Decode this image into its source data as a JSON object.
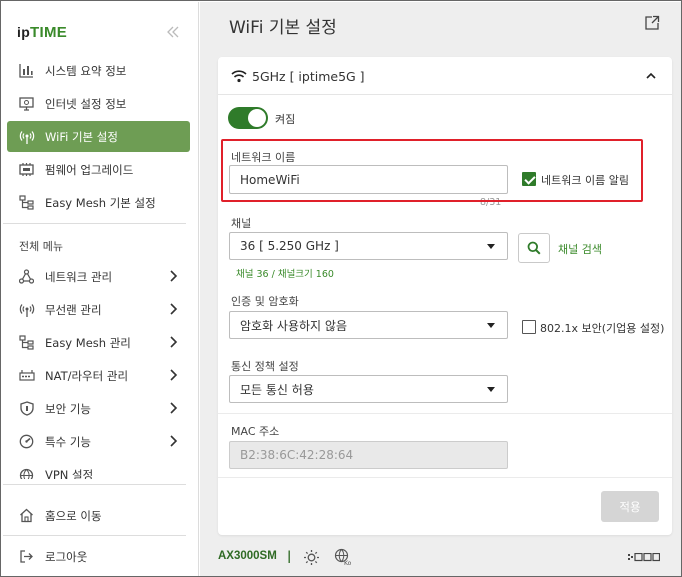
{
  "brand": {
    "logo_prefix": "ip",
    "logo_suffix": "TIME"
  },
  "sidebar": {
    "top_items": [
      {
        "label": "시스템 요약 정보",
        "icon": "bar-chart-icon"
      },
      {
        "label": "인터넷 설정 정보",
        "icon": "monitor-icon"
      },
      {
        "label": "WiFi 기본 설정",
        "icon": "wireless-icon",
        "active": true
      },
      {
        "label": "펌웨어 업그레이드",
        "icon": "chip-icon"
      },
      {
        "label": "Easy Mesh 기본 설정",
        "icon": "mesh-icon"
      }
    ],
    "section_title": "전체 메뉴",
    "menu_items": [
      {
        "label": "네트워크 관리",
        "icon": "network-icon"
      },
      {
        "label": "무선랜 관리",
        "icon": "wireless-icon"
      },
      {
        "label": "Easy Mesh 관리",
        "icon": "mesh-icon"
      },
      {
        "label": "NAT/라우터 관리",
        "icon": "router-icon"
      },
      {
        "label": "보안 기능",
        "icon": "shield-icon"
      },
      {
        "label": "특수 기능",
        "icon": "gauge-icon"
      },
      {
        "label": "VPN 설정",
        "icon": "vpn-icon"
      }
    ],
    "home_label": "홈으로 이동",
    "logout_label": "로그아웃"
  },
  "main": {
    "title": "WiFi 기본 설정",
    "card": {
      "band_title": "5GHz [ iptime5G ]",
      "toggle_label": "켜짐",
      "toggle_on": true,
      "ssid": {
        "label": "네트워크 이름",
        "value": "HomeWiFi",
        "counter": "8/31",
        "broadcast_label": "네트워크 이름 알림",
        "broadcast_checked": true
      },
      "channel": {
        "label": "채널",
        "selected": "36 [ 5.250 GHz ]",
        "hint": "채널 36 / 채널크기 160",
        "search_label": "채널 검색"
      },
      "auth": {
        "label": "인증 및 암호화",
        "selected": "암호화 사용하지 않음",
        "enterprise_label": "802.1x 보안(기업용 설정)",
        "enterprise_checked": false
      },
      "policy": {
        "label": "통신 정책 설정",
        "selected": "모든 통신 허용"
      },
      "mac": {
        "label": "MAC 주소",
        "value": "B2:38:6C:42:28:64"
      },
      "apply_label": "적용"
    }
  },
  "footer": {
    "model": "AX3000SM",
    "separator": "|"
  },
  "colors": {
    "accent": "#6e9d54",
    "brand_green": "#2f7b2a",
    "highlight": "#e0202a"
  }
}
